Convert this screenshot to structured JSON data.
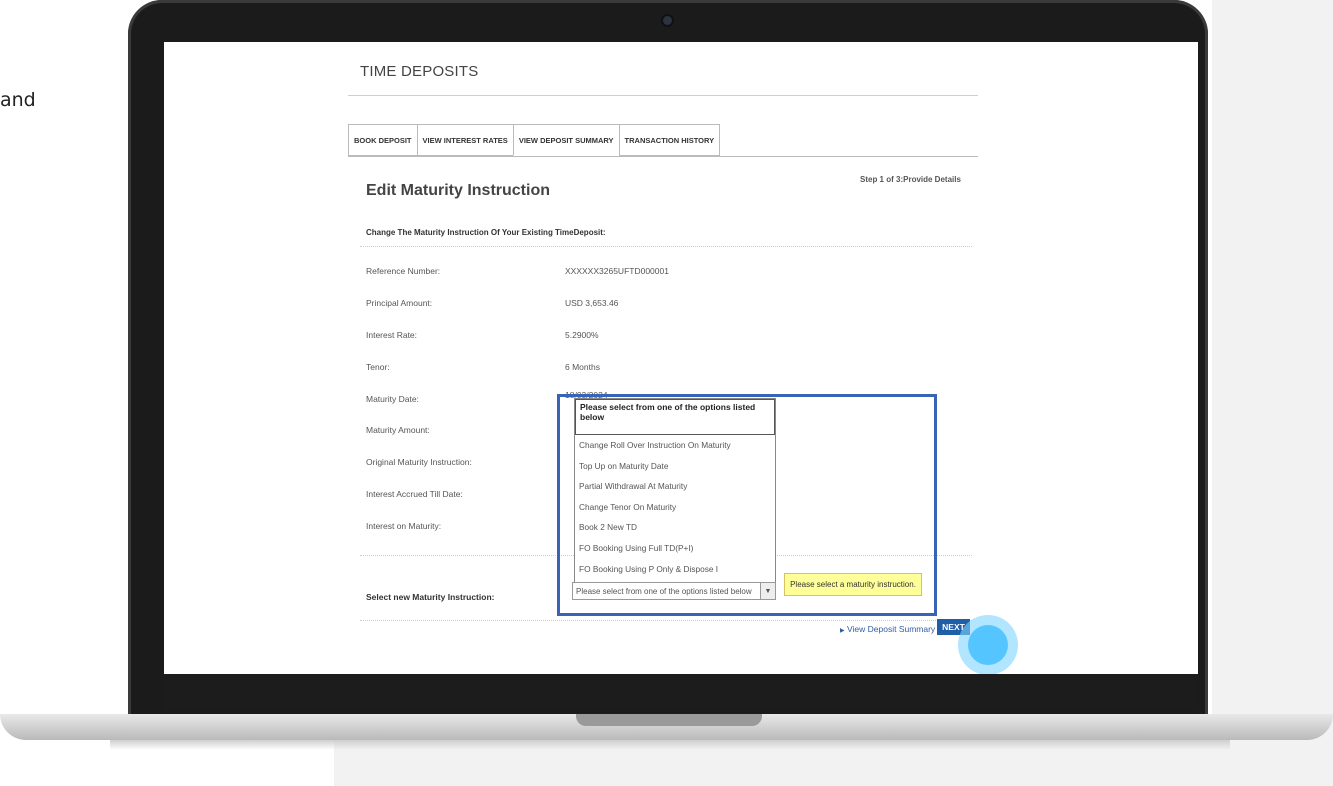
{
  "side_text": "and",
  "page": {
    "title": "TIME DEPOSITS",
    "tabs": [
      "BOOK DEPOSIT",
      "VIEW INTEREST RATES",
      "VIEW DEPOSIT SUMMARY",
      "TRANSACTION HISTORY"
    ],
    "active_tab": "VIEW DEPOSIT SUMMARY",
    "step": "Step 1 of 3:Provide Details",
    "heading": "Edit Maturity Instruction",
    "subheading": "Change The Maturity Instruction Of Your Existing TimeDeposit:"
  },
  "details": [
    {
      "label": "Reference Number:",
      "value": "XXXXXX3265UFTD000001"
    },
    {
      "label": "Principal Amount:",
      "value": "USD 3,653.46"
    },
    {
      "label": "Interest Rate:",
      "value": "5.2900%"
    },
    {
      "label": "Tenor:",
      "value": "6 Months"
    },
    {
      "label": "Maturity Date:",
      "value": "18/03/2024"
    },
    {
      "label": "Maturity Amount:",
      "value": ""
    },
    {
      "label": "Original Maturity Instruction:",
      "value": ""
    },
    {
      "label": "Interest Accrued Till Date:",
      "value": ""
    },
    {
      "label": "Interest on Maturity:",
      "value": ""
    }
  ],
  "dropdown": {
    "header": "Please select from one of the options listed below",
    "options": [
      "Change Roll Over Instruction On Maturity",
      "Top Up on Maturity Date",
      "Partial Withdrawal At Maturity",
      "Change Tenor On Maturity",
      "Book 2 New TD",
      "FO Booking Using Full TD(P+I)",
      "FO Booking Using P Only & Dispose I"
    ]
  },
  "select": {
    "label": "Select new Maturity Instruction:",
    "value": "Please select from one of the options listed below",
    "tooltip": "Please select a maturity instruction."
  },
  "actions": {
    "view_summary": "View Deposit Summary",
    "next": "NEXT"
  },
  "colors": {
    "highlight": "#3a63b8",
    "next_button": "#1f5fa8",
    "tooltip_bg": "#ffff99",
    "click_indicator": "#4fc3ff"
  }
}
